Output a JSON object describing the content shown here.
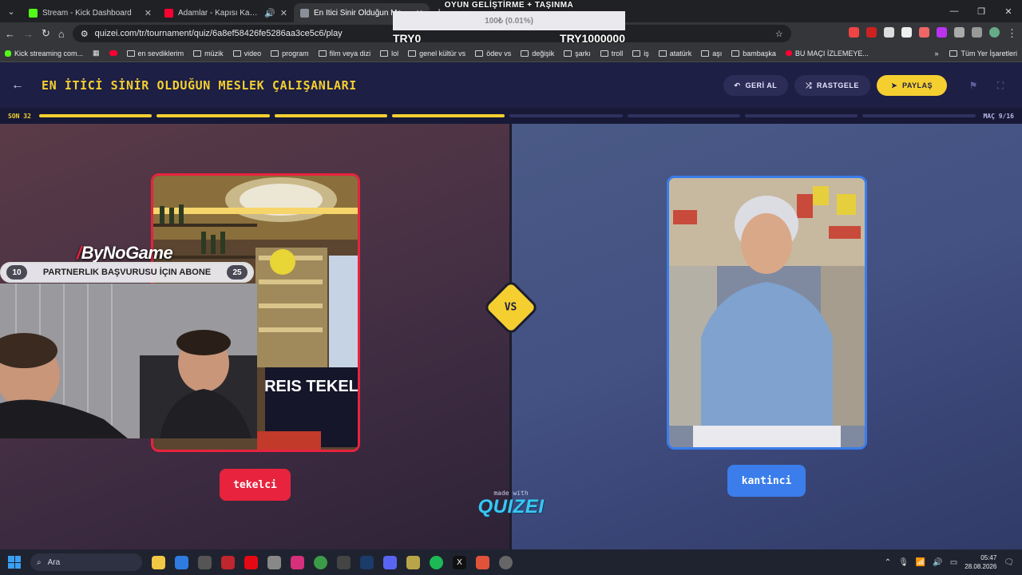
{
  "browser": {
    "tabs": [
      {
        "title": "Stream - Kick Dashboard",
        "color": "#53fc18",
        "active": false
      },
      {
        "title": "Adamlar - Kapısı Kapalı (Offi",
        "color": "#ff0033",
        "active": false
      },
      {
        "title": "En İtici Sinir Olduğun Meslek Ç",
        "color": "#8a8f99",
        "active": true
      }
    ],
    "url": "quizei.com/tr/tournament/quiz/6a8ef58426fe5286aa3ce5c6/play",
    "bookmarks": [
      "Kick streaming com...",
      "en sevdiklerim",
      "müzik",
      "video",
      "program",
      "film veya dizi",
      "lol",
      "genel kültür vs",
      "ödev vs",
      "değişik",
      "şarkı",
      "troll",
      "iş",
      "atatürk",
      "aşı",
      "bambaşka",
      "BU MAÇI İZLEMEYE..."
    ],
    "all_bookmarks": "Tüm Yer İşaretleri"
  },
  "donation": {
    "title": "OYUN GELİŞTİRME + TAŞINMA",
    "percent_label": "100₺ (0.01%)",
    "progress_fraction": 0.0001,
    "min": "TRY0",
    "max": "TRY1000000"
  },
  "quiz": {
    "title": "EN İTİCİ SİNİR OLDUĞUN MESLEK ÇALIŞANLARI",
    "undo_label": "GERİ AL",
    "random_label": "RASTGELE",
    "share_label": "PAYLAŞ",
    "round_label": "SON 32",
    "match_label": "MAÇ 9/16",
    "match_current": 9,
    "match_total": 16,
    "vs_label": "VS",
    "left_choice": "tekelci",
    "right_choice": "kantinci",
    "made_with": "made with",
    "brand": "QUIZEI",
    "colors": {
      "accent": "#f5cf30",
      "left": "#e8233e",
      "right": "#3b7dea"
    }
  },
  "overlay": {
    "sponsor": "ByNoGame",
    "partner_left": "10",
    "partner_text": "PARTNERLIK BAŞVURUSU İÇIN ABONE",
    "partner_right": "25",
    "shop_sign": "REIS TEKEL"
  },
  "taskbar": {
    "search_placeholder": "Ara",
    "time": "05:47",
    "date": "28.08.2026"
  }
}
